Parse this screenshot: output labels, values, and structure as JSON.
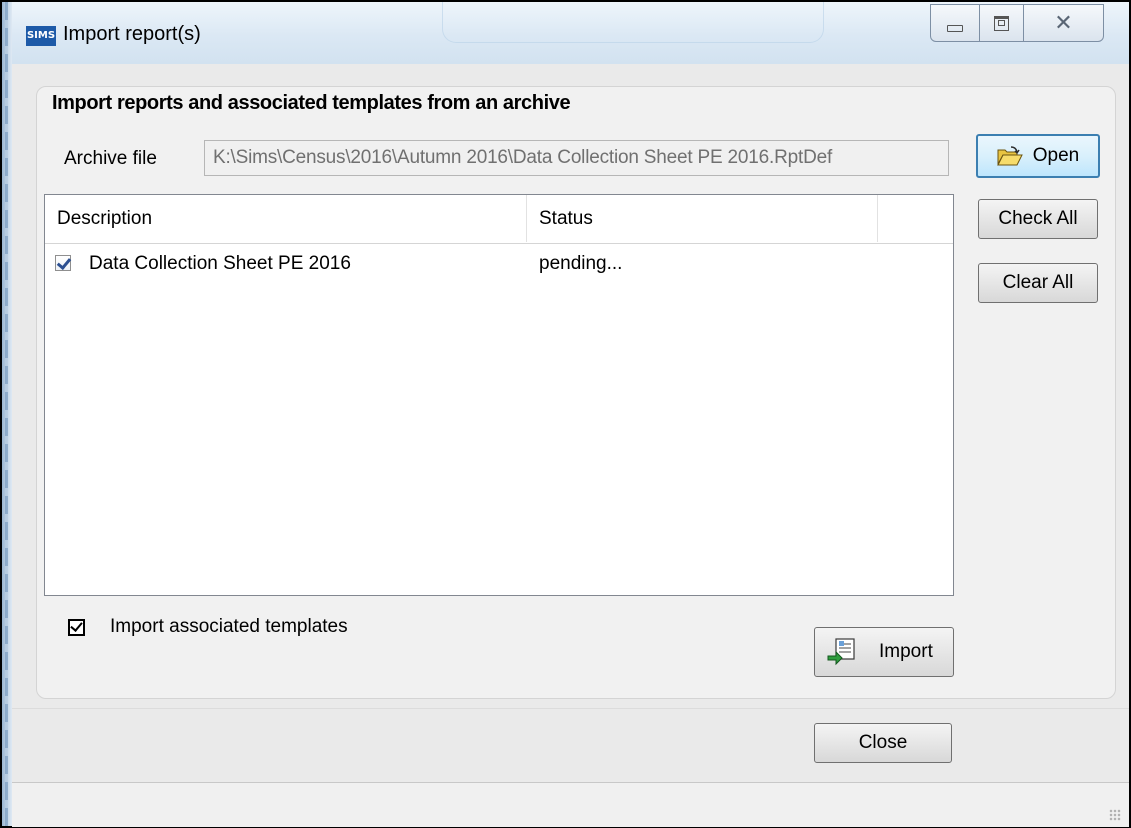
{
  "window": {
    "title": "Import report(s)",
    "app_icon_text": "SIMS",
    "controls": {
      "close_glyph": "✕"
    }
  },
  "group": {
    "title": "Import reports and associated templates from an archive"
  },
  "archive": {
    "label": "Archive file",
    "path": "K:\\Sims\\Census\\2016\\Autumn 2016\\Data Collection Sheet PE 2016.RptDef"
  },
  "buttons": {
    "open": "Open",
    "check_all": "Check All",
    "clear_all": "Clear All",
    "import": "Import",
    "close": "Close"
  },
  "list": {
    "columns": [
      "Description",
      "Status",
      ""
    ],
    "rows": [
      {
        "checked": true,
        "description": "Data Collection Sheet PE 2016",
        "status": "pending..."
      }
    ]
  },
  "options": {
    "import_templates_label": "Import associated templates",
    "import_templates_checked": true
  },
  "colors": {
    "accent": "#3c7fb1",
    "title_bg": "#dbe8f4",
    "client_bg": "#eaeaea"
  }
}
